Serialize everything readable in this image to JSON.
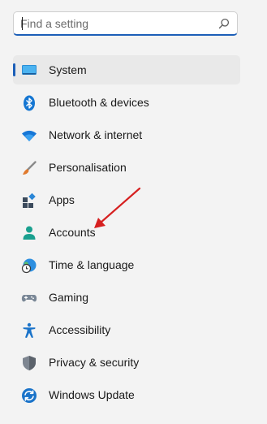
{
  "search": {
    "placeholder": "Find a setting",
    "icon": "search-icon"
  },
  "sidebar": {
    "selected_index": 0,
    "accent_color": "#1c5fb8",
    "items": [
      {
        "label": "System",
        "icon": "monitor-icon"
      },
      {
        "label": "Bluetooth & devices",
        "icon": "bluetooth-icon"
      },
      {
        "label": "Network & internet",
        "icon": "wifi-icon"
      },
      {
        "label": "Personalisation",
        "icon": "paintbrush-icon"
      },
      {
        "label": "Apps",
        "icon": "apps-icon"
      },
      {
        "label": "Accounts",
        "icon": "person-icon"
      },
      {
        "label": "Time & language",
        "icon": "globe-clock-icon"
      },
      {
        "label": "Gaming",
        "icon": "gamepad-icon"
      },
      {
        "label": "Accessibility",
        "icon": "accessibility-icon"
      },
      {
        "label": "Privacy & security",
        "icon": "shield-icon"
      },
      {
        "label": "Windows Update",
        "icon": "update-icon"
      }
    ]
  },
  "annotation": {
    "arrow_color": "#d62020",
    "points_to": "Accounts"
  }
}
